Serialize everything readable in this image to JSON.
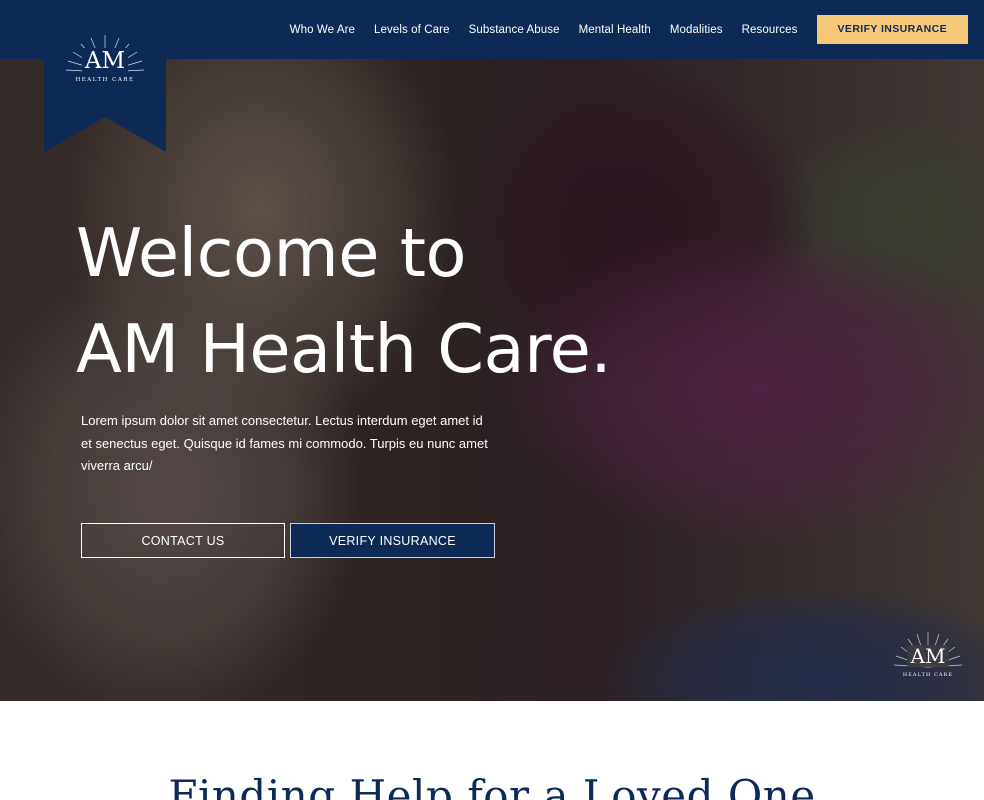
{
  "brand": {
    "monogram": "AM",
    "tagline": "HEALTH CARE"
  },
  "nav": {
    "links": [
      "Who We Are",
      "Levels of Care",
      "Substance Abuse",
      "Mental Health",
      "Modalities",
      "Resources"
    ],
    "cta_label": "VERIFY INSURANCE"
  },
  "hero": {
    "title_line1": "Welcome to",
    "title_line2": "AM Health Care.",
    "body": "Lorem ipsum dolor sit amet consectetur. Lectus interdum eget amet id et senectus eget. Quisque id fames mi commodo. Turpis eu nunc amet viverra arcu/",
    "contact_label": "CONTACT US",
    "verify_label": "VERIFY INSURANCE"
  },
  "section": {
    "title": "Finding Help for a Loved One"
  },
  "colors": {
    "navy": "#0d2a57",
    "gold": "#f6c97a",
    "white": "#ffffff"
  },
  "icons": {
    "logo": "am-sunburst-logo",
    "watermark": "am-sunburst-logo"
  }
}
